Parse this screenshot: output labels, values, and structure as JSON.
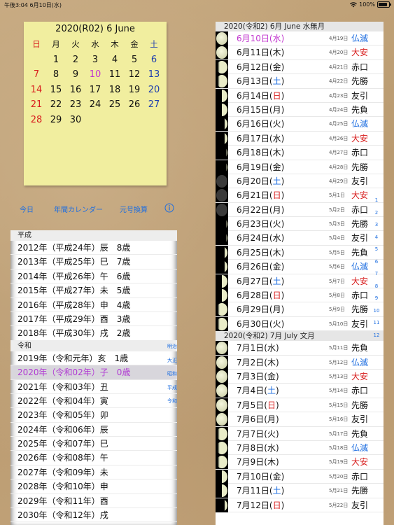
{
  "status_bar": {
    "time": "午後3:04",
    "date": "6月10日(水)",
    "battery": "100%"
  },
  "calendar": {
    "title": "2020(R02) 6 June",
    "weekdays": [
      "日",
      "月",
      "火",
      "水",
      "木",
      "金",
      "土"
    ],
    "days": [
      "",
      "1",
      "2",
      "3",
      "4",
      "5",
      "6",
      "7",
      "8",
      "9",
      "10",
      "11",
      "12",
      "13",
      "14",
      "15",
      "16",
      "17",
      "18",
      "19",
      "20",
      "21",
      "22",
      "23",
      "24",
      "25",
      "26",
      "27",
      "28",
      "29",
      "30"
    ],
    "today": "10"
  },
  "toolbar": {
    "today": "今日",
    "year_calendar": "年間カレンダー",
    "era_convert": "元号換算",
    "info_icon": "info-icon"
  },
  "era_list": {
    "sections": [
      {
        "label": "平成",
        "rows": [
          "2012年（平成24年）辰　8歳",
          "2013年（平成25年）巳　7歳",
          "2014年（平成26年）午　6歳",
          "2015年（平成27年）未　5歳",
          "2016年（平成28年）申　4歳",
          "2017年（平成29年）酉　3歳",
          "2018年（平成30年）戌　2歳"
        ]
      },
      {
        "label": "令和",
        "rows": [
          "2019年（令和元年）亥　1歳",
          "2020年（令和02年）子　0歳",
          "2021年（令和03年）丑",
          "2022年（令和04年）寅",
          "2023年（令和05年）卯",
          "2024年（令和06年）辰",
          "2025年（令和07年）巳",
          "2026年（令和08年）午",
          "2027年（令和09年）未",
          "2028年（令和10年）申",
          "2029年（令和11年）酉",
          "2030年（令和12年）戌"
        ]
      }
    ],
    "selected": "2020年（令和02年）子　0歳",
    "index": [
      "明治",
      "大正",
      "昭和",
      "平成",
      "令和"
    ]
  },
  "day_list": {
    "sections": [
      {
        "header": "2020(令和2) 6月 June 水無月",
        "rows": [
          {
            "date": "6月10日",
            "wd": "水",
            "lunar": "4月19日",
            "rk": "仏滅",
            "type": "blue",
            "moon": "full"
          },
          {
            "date": "6月11日",
            "wd": "木",
            "lunar": "4月20日",
            "rk": "大安",
            "type": "red",
            "moon": "full"
          },
          {
            "date": "6月12日",
            "wd": "金",
            "lunar": "4月21日",
            "rk": "赤口",
            "type": "",
            "moon": "gibbous"
          },
          {
            "date": "6月13日",
            "wd": "土",
            "lunar": "4月22日",
            "rk": "先勝",
            "type": "",
            "moon": "gibbous"
          },
          {
            "date": "6月14日",
            "wd": "日",
            "lunar": "4月23日",
            "rk": "友引",
            "type": "",
            "moon": "half"
          },
          {
            "date": "6月15日",
            "wd": "月",
            "lunar": "4月24日",
            "rk": "先負",
            "type": "",
            "moon": "half"
          },
          {
            "date": "6月16日",
            "wd": "火",
            "lunar": "4月25日",
            "rk": "仏滅",
            "type": "blue",
            "moon": "crescent"
          },
          {
            "date": "6月17日",
            "wd": "水",
            "lunar": "4月26日",
            "rk": "大安",
            "type": "red",
            "moon": "crescent"
          },
          {
            "date": "6月18日",
            "wd": "木",
            "lunar": "4月27日",
            "rk": "赤口",
            "type": "",
            "moon": "thin"
          },
          {
            "date": "6月19日",
            "wd": "金",
            "lunar": "4月28日",
            "rk": "先勝",
            "type": "",
            "moon": "thin"
          },
          {
            "date": "6月20日",
            "wd": "土",
            "lunar": "4月29日",
            "rk": "友引",
            "type": "",
            "moon": "new"
          },
          {
            "date": "6月21日",
            "wd": "日",
            "lunar": "5月1日",
            "rk": "大安",
            "type": "red",
            "moon": "new"
          },
          {
            "date": "6月22日",
            "wd": "月",
            "lunar": "5月2日",
            "rk": "赤口",
            "type": "",
            "moon": "new"
          },
          {
            "date": "6月23日",
            "wd": "火",
            "lunar": "5月3日",
            "rk": "先勝",
            "type": "",
            "moon": "thin"
          },
          {
            "date": "6月24日",
            "wd": "水",
            "lunar": "5月4日",
            "rk": "友引",
            "type": "",
            "moon": "thin"
          },
          {
            "date": "6月25日",
            "wd": "木",
            "lunar": "5月5日",
            "rk": "先負",
            "type": "",
            "moon": "crescent"
          },
          {
            "date": "6月26日",
            "wd": "金",
            "lunar": "5月6日",
            "rk": "仏滅",
            "type": "blue",
            "moon": "crescent"
          },
          {
            "date": "6月27日",
            "wd": "土",
            "lunar": "5月7日",
            "rk": "大安",
            "type": "red",
            "moon": "half"
          },
          {
            "date": "6月28日",
            "wd": "日",
            "lunar": "5月8日",
            "rk": "赤口",
            "type": "",
            "moon": "half"
          },
          {
            "date": "6月29日",
            "wd": "月",
            "lunar": "5月9日",
            "rk": "先勝",
            "type": "",
            "moon": "gibbous"
          },
          {
            "date": "6月30日",
            "wd": "火",
            "lunar": "5月10日",
            "rk": "友引",
            "type": "",
            "moon": "gibbous"
          }
        ]
      },
      {
        "header": "2020(令和2) 7月 July 文月",
        "rows": [
          {
            "date": "7月1日",
            "wd": "水",
            "lunar": "5月11日",
            "rk": "先負",
            "type": "",
            "moon": "full"
          },
          {
            "date": "7月2日",
            "wd": "木",
            "lunar": "5月12日",
            "rk": "仏滅",
            "type": "blue",
            "moon": "full"
          },
          {
            "date": "7月3日",
            "wd": "金",
            "lunar": "5月13日",
            "rk": "大安",
            "type": "red",
            "moon": "full"
          },
          {
            "date": "7月4日",
            "wd": "土",
            "lunar": "5月14日",
            "rk": "赤口",
            "type": "",
            "moon": "full"
          },
          {
            "date": "7月5日",
            "wd": "日",
            "lunar": "5月15日",
            "rk": "先勝",
            "type": "",
            "moon": "full"
          },
          {
            "date": "7月6日",
            "wd": "月",
            "lunar": "5月16日",
            "rk": "友引",
            "type": "",
            "moon": "full"
          },
          {
            "date": "7月7日",
            "wd": "火",
            "lunar": "5月17日",
            "rk": "先負",
            "type": "",
            "moon": "gibbous"
          },
          {
            "date": "7月8日",
            "wd": "水",
            "lunar": "5月18日",
            "rk": "仏滅",
            "type": "blue",
            "moon": "gibbous"
          },
          {
            "date": "7月9日",
            "wd": "木",
            "lunar": "5月19日",
            "rk": "大安",
            "type": "red",
            "moon": "gibbous"
          },
          {
            "date": "7月10日",
            "wd": "金",
            "lunar": "5月20日",
            "rk": "赤口",
            "type": "",
            "moon": "half"
          },
          {
            "date": "7月11日",
            "wd": "土",
            "lunar": "5月21日",
            "rk": "先勝",
            "type": "",
            "moon": "half"
          },
          {
            "date": "7月12日",
            "wd": "日",
            "lunar": "5月22日",
            "rk": "友引",
            "type": "",
            "moon": "crescent"
          }
        ]
      }
    ],
    "month_index": [
      "1",
      "2",
      "3",
      "4",
      "5",
      "6",
      "7",
      "8",
      "9",
      "10",
      "11",
      "12"
    ]
  },
  "colors": {
    "sunday": "#d81e1e",
    "saturday": "#1f3fae",
    "today": "#c236cf",
    "link": "#1e6ee0",
    "note": "#f1ee9f"
  }
}
